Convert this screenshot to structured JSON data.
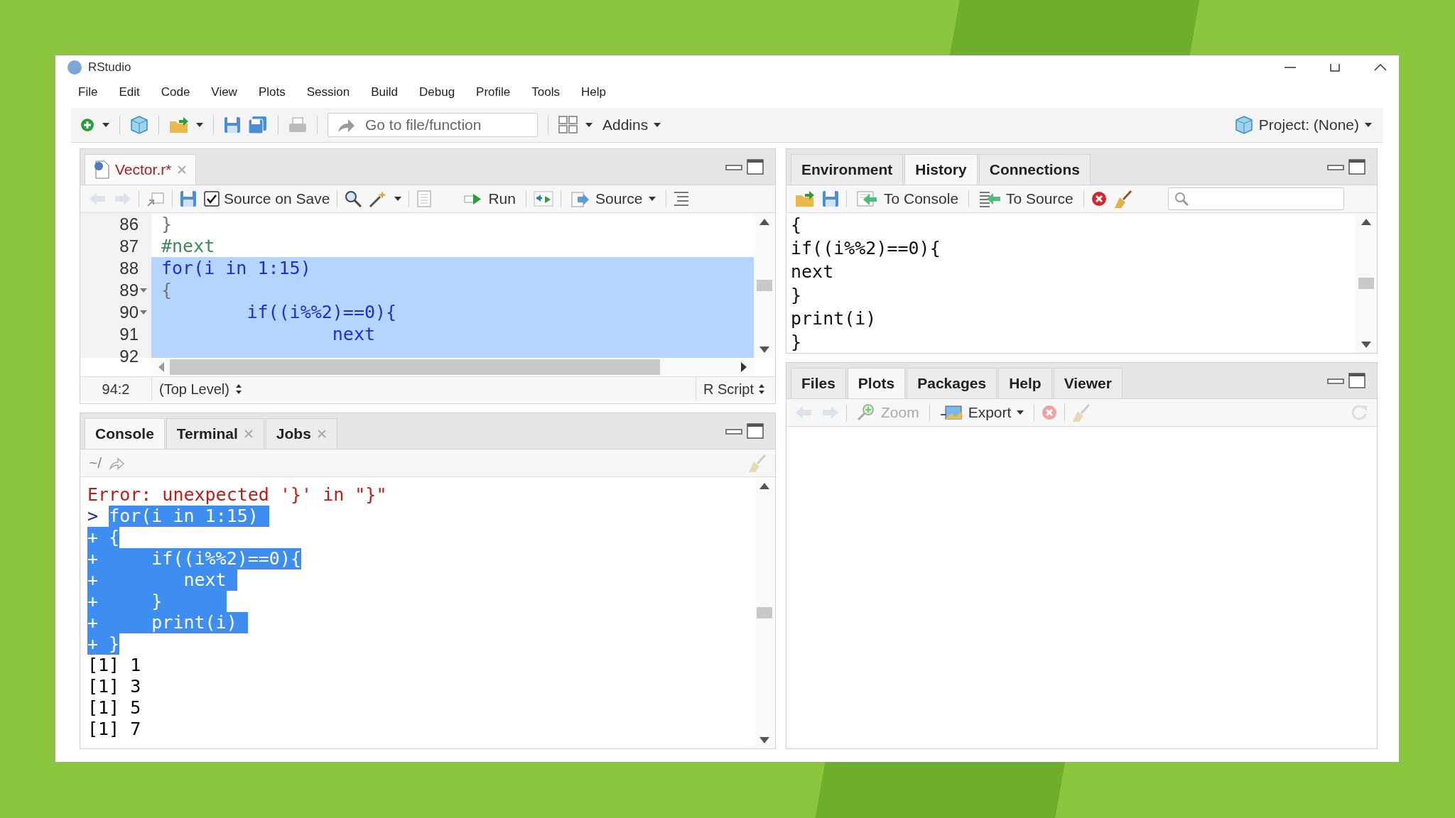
{
  "window": {
    "title": "RStudio"
  },
  "menu": [
    "File",
    "Edit",
    "Code",
    "View",
    "Plots",
    "Session",
    "Build",
    "Debug",
    "Profile",
    "Tools",
    "Help"
  ],
  "toolbar": {
    "goto_placeholder": "Go to file/function",
    "addins": "Addins",
    "project": "Project: (None)"
  },
  "editor": {
    "tabs": [
      {
        "label": "Vector.r*",
        "selected": true
      }
    ],
    "source_on_save": {
      "label": "Source on Save",
      "checked": true
    },
    "run": "Run",
    "source": "Source",
    "lines": [
      {
        "number": "86",
        "code": "}",
        "kind": "brace",
        "selected": false,
        "fold": false
      },
      {
        "number": "87",
        "code": "#next",
        "kind": "comment",
        "selected": false,
        "fold": false
      },
      {
        "number": "88",
        "code": "for(i in 1:15)",
        "kind": "code",
        "selected": true,
        "fold": false
      },
      {
        "number": "89",
        "code": "{",
        "kind": "brace",
        "selected": true,
        "fold": true
      },
      {
        "number": "90",
        "code": "        if((i%%2)==0){",
        "kind": "code",
        "selected": true,
        "fold": true
      },
      {
        "number": "91",
        "code": "                next",
        "kind": "code",
        "selected": true,
        "fold": false
      },
      {
        "number": "92",
        "kind": "brace",
        "selected": true,
        "fold": false
      }
    ],
    "status": {
      "position": "94:2",
      "scope": "(Top Level)",
      "file_type": "R Script"
    }
  },
  "console": {
    "tabs": [
      {
        "label": "Console",
        "selected": true,
        "closable": false
      },
      {
        "label": "Terminal",
        "selected": false,
        "closable": true
      },
      {
        "label": "Jobs",
        "selected": false,
        "closable": true
      }
    ],
    "path": "~/",
    "lines": [
      {
        "kind": "error",
        "text": "Error: unexpected '}' in \"}\"",
        "selected": false
      },
      {
        "kind": "input",
        "prompt": ">",
        "text": "for(i in 1:15) ",
        "selected": true
      },
      {
        "kind": "continuation",
        "prompt": "+",
        "text": "{",
        "selected": true
      },
      {
        "kind": "continuation",
        "prompt": "+",
        "text": "    if((i%%2)==0){",
        "selected": true
      },
      {
        "kind": "continuation",
        "prompt": "+",
        "text": "       next ",
        "selected": true
      },
      {
        "kind": "continuation",
        "prompt": "+",
        "text": "    }      ",
        "selected": true
      },
      {
        "kind": "continuation",
        "prompt": "+",
        "text": "    print(i) ",
        "selected": true
      },
      {
        "kind": "continuation",
        "prompt": "+",
        "text": "}",
        "selected": true
      },
      {
        "kind": "output",
        "text": "[1] 1",
        "selected": false
      },
      {
        "kind": "output",
        "text": "[1] 3",
        "selected": false
      },
      {
        "kind": "output",
        "text": "[1] 5",
        "selected": false
      },
      {
        "kind": "output",
        "text": "[1] 7",
        "selected": false
      }
    ]
  },
  "history": {
    "tabs": [
      {
        "label": "Environment",
        "selected": false
      },
      {
        "label": "History",
        "selected": true
      },
      {
        "label": "Connections",
        "selected": false
      }
    ],
    "to_console": "To Console",
    "to_source": "To Source",
    "lines": [
      "{",
      "if((i%%2)==0){",
      "next",
      "}",
      "print(i)",
      "}"
    ]
  },
  "plots": {
    "tabs": [
      {
        "label": "Files",
        "selected": false
      },
      {
        "label": "Plots",
        "selected": true
      },
      {
        "label": "Packages",
        "selected": false
      },
      {
        "label": "Help",
        "selected": false
      },
      {
        "label": "Viewer",
        "selected": false
      }
    ],
    "zoom": {
      "label": "Zoom",
      "disabled": true
    },
    "export": "Export"
  }
}
